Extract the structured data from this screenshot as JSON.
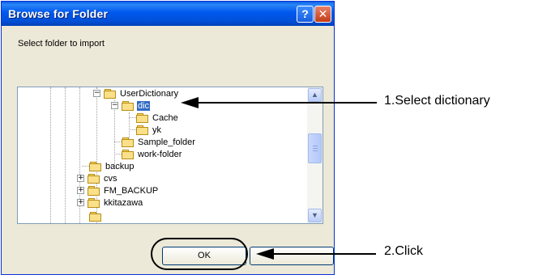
{
  "dialog": {
    "title": "Browse for Folder",
    "help_label": "?",
    "close_label": "✕",
    "prompt": "Select folder to import"
  },
  "tree": {
    "items": [
      {
        "label": "UserDictionary",
        "expander": "−",
        "selected": false
      },
      {
        "label": "dic",
        "expander": "−",
        "selected": true
      },
      {
        "label": "Cache",
        "expander": "",
        "selected": false
      },
      {
        "label": "yk",
        "expander": "",
        "selected": false
      },
      {
        "label": "Sample_folder",
        "expander": "",
        "selected": false
      },
      {
        "label": "work-folder",
        "expander": "",
        "selected": false
      },
      {
        "label": "backup",
        "expander": "",
        "selected": false
      },
      {
        "label": "cvs",
        "expander": "+",
        "selected": false
      },
      {
        "label": "FM_BACKUP",
        "expander": "+",
        "selected": false
      },
      {
        "label": "kkitazawa",
        "expander": "+",
        "selected": false
      }
    ]
  },
  "scrollbar": {
    "up": "▲",
    "down": "▼"
  },
  "buttons": {
    "ok": "OK",
    "cancel": ""
  },
  "callouts": {
    "step1": "1.Select dictionary",
    "step2": "2.Click"
  },
  "colors": {
    "selection": "#316ac5",
    "titlebar": "#0058ee",
    "dialog_bg": "#ece9d8"
  }
}
